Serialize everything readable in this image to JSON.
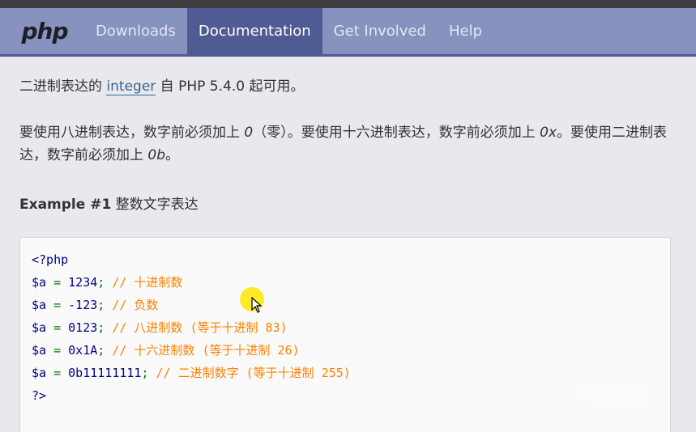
{
  "nav": {
    "logo": "php",
    "items": [
      {
        "label": "Downloads"
      },
      {
        "label": "Documentation"
      },
      {
        "label": "Get Involved"
      },
      {
        "label": "Help"
      }
    ]
  },
  "content": {
    "p1_before": "二进制表达的 ",
    "p1_link": "integer",
    "p1_after": " 自 PHP 5.4.0 起可用。",
    "p2_a": "要使用八进制表达，数字前必须加上 ",
    "p2_b": "0",
    "p2_c": "（零）。要使用十六进制表达，数字前必须加上 ",
    "p2_d": "0x",
    "p2_e": "。要使用二进制表达，数字前必须加上 ",
    "p2_f": "0b",
    "p2_g": "。",
    "example_label": "Example #1",
    "example_title": " 整数文字表达"
  },
  "code": {
    "open": "<?php",
    "lines": [
      {
        "var": "$a",
        "eq": " = ",
        "num": "1234",
        "semi": "; ",
        "comment": "// 十进制数"
      },
      {
        "var": "$a",
        "eq": " = ",
        "num": "-123",
        "semi": "; ",
        "comment": "// 负数"
      },
      {
        "var": "$a",
        "eq": " = ",
        "num": "0123",
        "semi": "; ",
        "comment": "// 八进制数 (等于十进制 83)"
      },
      {
        "var": "$a",
        "eq": " = ",
        "num": "0x1A",
        "semi": "; ",
        "comment": "// 十六进制数 (等于十进制 26)"
      },
      {
        "var": "$a",
        "eq": " = ",
        "num": "0b11111111",
        "semi": "; ",
        "comment": "// 二进制数字 (等于十进制 255)"
      }
    ],
    "close": "?>"
  },
  "watermark": "那个铃铛很起眼\n12465248"
}
